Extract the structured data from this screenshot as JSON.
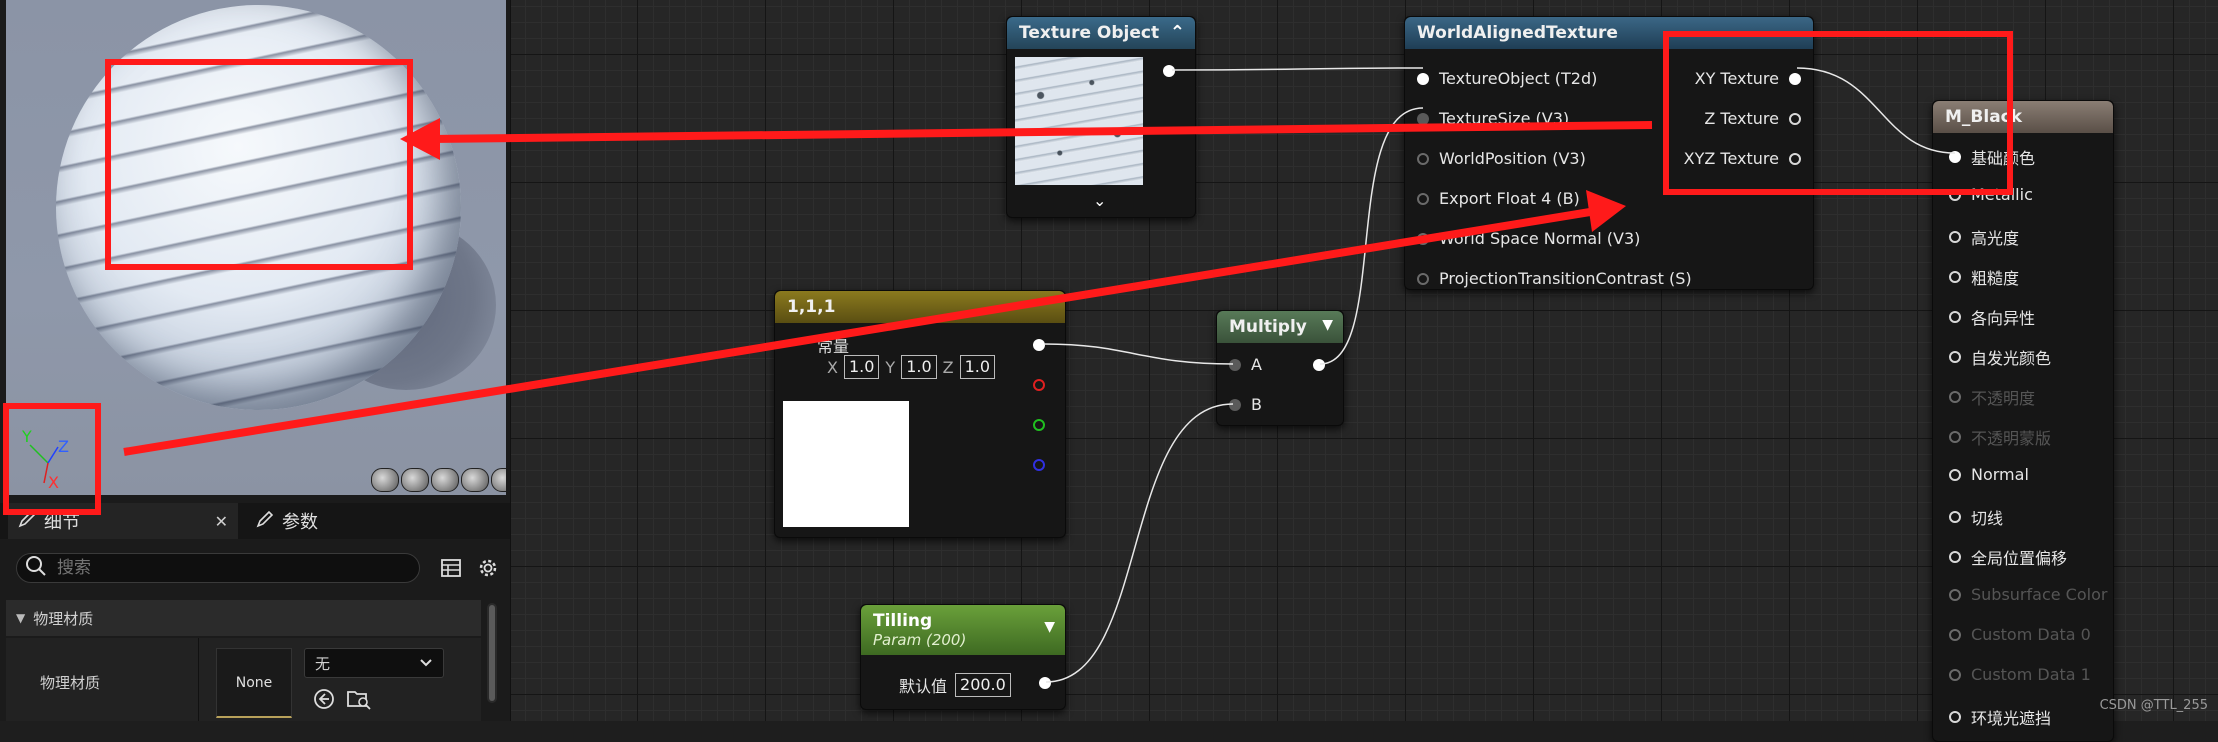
{
  "details_panel": {
    "tab_details": "细节",
    "tab_params": "参数",
    "search_placeholder": "搜索",
    "category": "物理材质",
    "property_label": "物理材质",
    "thumbnail_text": "None",
    "dropdown_value": "无"
  },
  "viewport": {
    "axis_x": "X",
    "axis_y": "Y",
    "axis_z": "Z"
  },
  "nodes": {
    "texture_object": {
      "title": "Texture Object"
    },
    "world_aligned": {
      "title": "WorldAlignedTexture",
      "inputs": [
        "TextureObject (T2d)",
        "TextureSize (V3)",
        "WorldPosition (V3)",
        "Export Float 4 (B)",
        "World Space Normal (V3)",
        "ProjectionTransitionContrast (S)"
      ],
      "outputs": [
        "XY Texture",
        "Z Texture",
        "XYZ Texture"
      ]
    },
    "constant3": {
      "title": "1,1,1",
      "subtitle": "常量",
      "x_label": "X",
      "x_value": "1.0",
      "y_label": "Y",
      "y_value": "1.0",
      "z_label": "Z",
      "z_value": "1.0"
    },
    "multiply": {
      "title": "Multiply",
      "input_a": "A",
      "input_b": "B"
    },
    "tilling": {
      "title": "Tilling",
      "subtitle": "Param (200)",
      "default_label": "默认值",
      "default_value": "200.0"
    },
    "material": {
      "title": "M_Black",
      "pins": [
        {
          "label": "基础颜色",
          "enabled": true
        },
        {
          "label": "Metallic",
          "enabled": true
        },
        {
          "label": "高光度",
          "enabled": true
        },
        {
          "label": "粗糙度",
          "enabled": true
        },
        {
          "label": "各向异性",
          "enabled": true
        },
        {
          "label": "自发光颜色",
          "enabled": true
        },
        {
          "label": "不透明度",
          "enabled": false
        },
        {
          "label": "不透明蒙版",
          "enabled": false
        },
        {
          "label": "Normal",
          "enabled": true
        },
        {
          "label": "切线",
          "enabled": true
        },
        {
          "label": "全局位置偏移",
          "enabled": true
        },
        {
          "label": "Subsurface Color",
          "enabled": false
        },
        {
          "label": "Custom Data 0",
          "enabled": false
        },
        {
          "label": "Custom Data 1",
          "enabled": false
        },
        {
          "label": "环境光遮挡",
          "enabled": true
        }
      ]
    }
  },
  "watermark": "CSDN @TTL_255",
  "colors": {
    "annotation_red": "#ff1a1a",
    "wire": "#e8e8e8"
  }
}
